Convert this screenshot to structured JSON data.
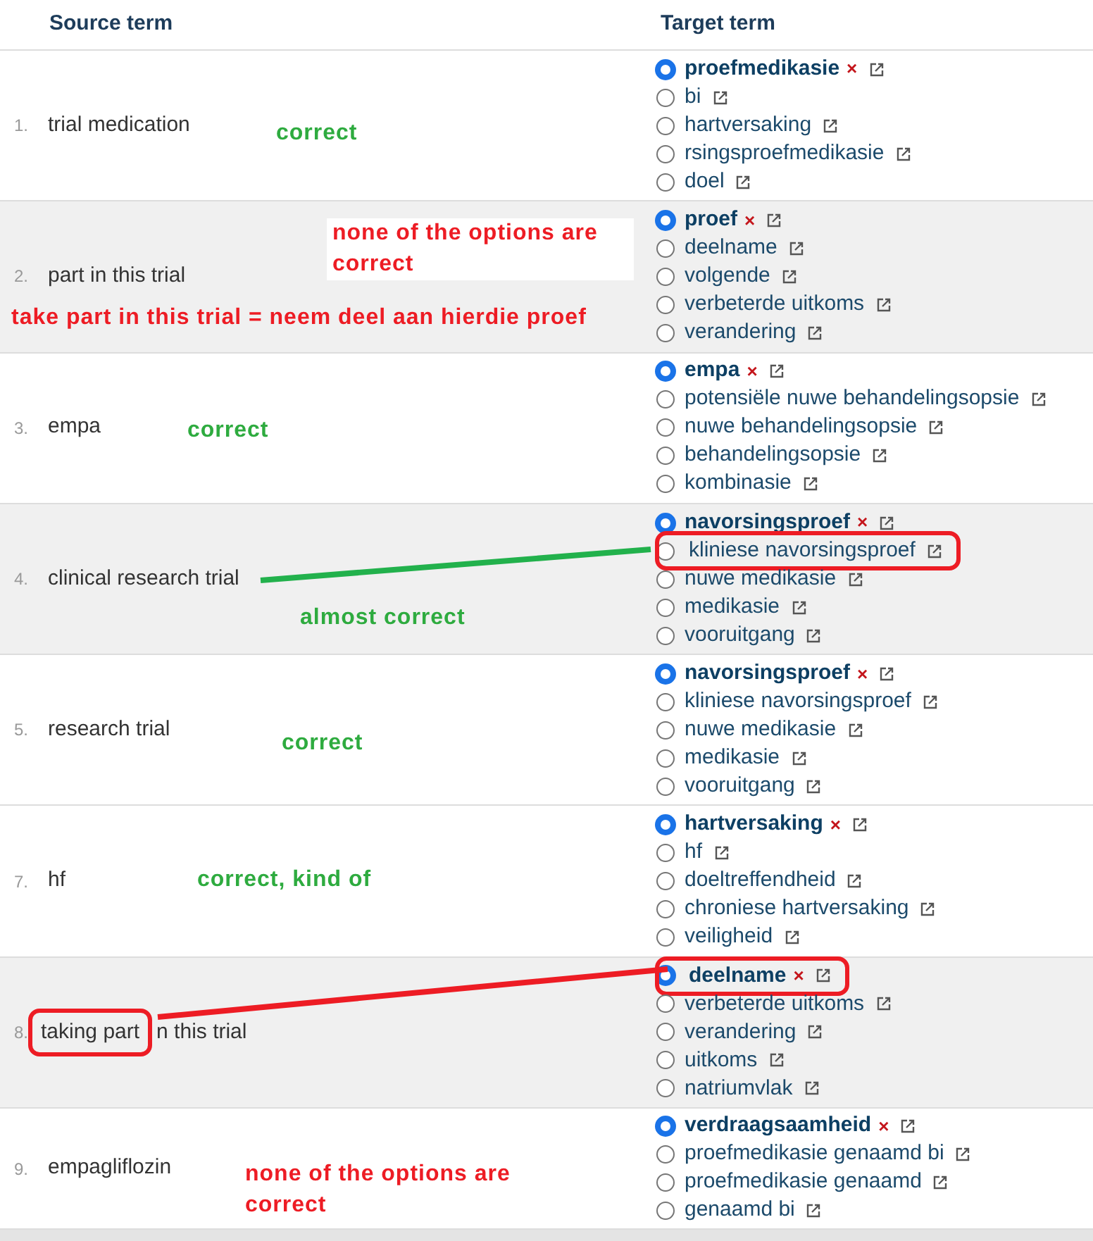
{
  "columns": [
    "Source term",
    "Target term"
  ],
  "rows": [
    {
      "number": "1.",
      "shaded": false,
      "source": [
        {
          "text": "trial medication",
          "circled": false
        }
      ],
      "notes": [
        {
          "text": "correct",
          "color": "#2eab3f",
          "boxed": false
        }
      ],
      "connector": null,
      "options": [
        {
          "label": "proefmedikasie",
          "selected": true,
          "circled": false,
          "remove": "×"
        },
        {
          "label": "bi",
          "selected": false,
          "circled": false
        },
        {
          "label": "hartversaking",
          "selected": false,
          "circled": false
        },
        {
          "label": "rsingsproefmedikasie",
          "selected": false,
          "circled": false
        },
        {
          "label": "doel",
          "selected": false,
          "circled": false
        }
      ]
    },
    {
      "number": "2.",
      "shaded": true,
      "source": [
        {
          "text": "part in this trial",
          "circled": false
        }
      ],
      "notes": [
        {
          "text": "none of the options are correct",
          "color": "#ed1c24",
          "boxed": true
        },
        {
          "text": "take part in this trial = neem deel aan hierdie proef",
          "color": "#ed1c24",
          "boxed": false
        }
      ],
      "connector": null,
      "options": [
        {
          "label": "proef",
          "selected": true,
          "circled": false,
          "remove": "×"
        },
        {
          "label": "deelname",
          "selected": false,
          "circled": false
        },
        {
          "label": "volgende",
          "selected": false,
          "circled": false
        },
        {
          "label": "verbeterde uitkoms",
          "selected": false,
          "circled": false
        },
        {
          "label": "verandering",
          "selected": false,
          "circled": false
        }
      ]
    },
    {
      "number": "3.",
      "shaded": false,
      "source": [
        {
          "text": "empa",
          "circled": false
        }
      ],
      "notes": [
        {
          "text": "correct",
          "color": "#2eab3f",
          "boxed": false
        }
      ],
      "connector": null,
      "options": [
        {
          "label": "empa",
          "selected": true,
          "circled": false,
          "remove": "×"
        },
        {
          "label": "potensiële nuwe behandelingsopsie",
          "selected": false,
          "circled": false
        },
        {
          "label": "nuwe behandelingsopsie",
          "selected": false,
          "circled": false
        },
        {
          "label": "behandelingsopsie",
          "selected": false,
          "circled": false
        },
        {
          "label": "kombinasie",
          "selected": false,
          "circled": false
        }
      ]
    },
    {
      "number": "4.",
      "shaded": true,
      "source": [
        {
          "text": "clinical research trial",
          "circled": false
        }
      ],
      "notes": [
        {
          "text": "almost correct",
          "color": "#2eab3f",
          "boxed": false
        }
      ],
      "connector": {
        "color": "#22b14c"
      },
      "options": [
        {
          "label": "navorsingsproef",
          "selected": true,
          "circled": false,
          "remove": "×"
        },
        {
          "label": "kliniese navorsingsproef",
          "selected": false,
          "circled": true
        },
        {
          "label": "nuwe medikasie",
          "selected": false,
          "circled": false
        },
        {
          "label": "medikasie",
          "selected": false,
          "circled": false
        },
        {
          "label": "vooruitgang",
          "selected": false,
          "circled": false
        }
      ]
    },
    {
      "number": "5.",
      "shaded": false,
      "source": [
        {
          "text": "research trial",
          "circled": false
        }
      ],
      "notes": [
        {
          "text": "correct",
          "color": "#2eab3f",
          "boxed": false
        }
      ],
      "connector": null,
      "options": [
        {
          "label": "navorsingsproef",
          "selected": true,
          "circled": false,
          "remove": "×"
        },
        {
          "label": "kliniese navorsingsproef",
          "selected": false,
          "circled": false
        },
        {
          "label": "nuwe medikasie",
          "selected": false,
          "circled": false
        },
        {
          "label": "medikasie",
          "selected": false,
          "circled": false
        },
        {
          "label": "vooruitgang",
          "selected": false,
          "circled": false
        }
      ]
    },
    {
      "number": "7.",
      "shaded": false,
      "source": [
        {
          "text": "hf",
          "circled": false
        }
      ],
      "notes": [
        {
          "text": "correct,  kind of",
          "color": "#2eab3f",
          "boxed": false
        }
      ],
      "connector": null,
      "options": [
        {
          "label": "hartversaking",
          "selected": true,
          "circled": false,
          "remove": "×"
        },
        {
          "label": "hf",
          "selected": false,
          "circled": false
        },
        {
          "label": "doeltreffendheid",
          "selected": false,
          "circled": false
        },
        {
          "label": "chroniese hartversaking",
          "selected": false,
          "circled": false
        },
        {
          "label": "veiligheid",
          "selected": false,
          "circled": false
        }
      ]
    },
    {
      "number": "8.",
      "shaded": true,
      "source": [
        {
          "text": "taking part",
          "circled": true
        },
        {
          "text": "n this trial",
          "circled": false
        }
      ],
      "notes": [],
      "connector": {
        "color": "#ed1c24"
      },
      "options": [
        {
          "label": "deelname",
          "selected": true,
          "circled": true,
          "remove": "×"
        },
        {
          "label": "verbeterde uitkoms",
          "selected": false,
          "circled": false
        },
        {
          "label": "verandering",
          "selected": false,
          "circled": false
        },
        {
          "label": "uitkoms",
          "selected": false,
          "circled": false
        },
        {
          "label": "natriumvlak",
          "selected": false,
          "circled": false
        }
      ]
    },
    {
      "number": "9.",
      "shaded": false,
      "source": [
        {
          "text": "empagliflozin",
          "circled": false
        }
      ],
      "notes": [
        {
          "text": "none of the options are correct",
          "color": "#ed1c24",
          "boxed": false
        }
      ],
      "connector": null,
      "options": [
        {
          "label": "verdraagsaamheid",
          "selected": true,
          "circled": false,
          "remove": "×"
        },
        {
          "label": "proefmedikasie genaamd bi",
          "selected": false,
          "circled": false
        },
        {
          "label": "proefmedikasie genaamd",
          "selected": false,
          "circled": false
        },
        {
          "label": "genaamd bi",
          "selected": false,
          "circled": false
        }
      ]
    }
  ]
}
